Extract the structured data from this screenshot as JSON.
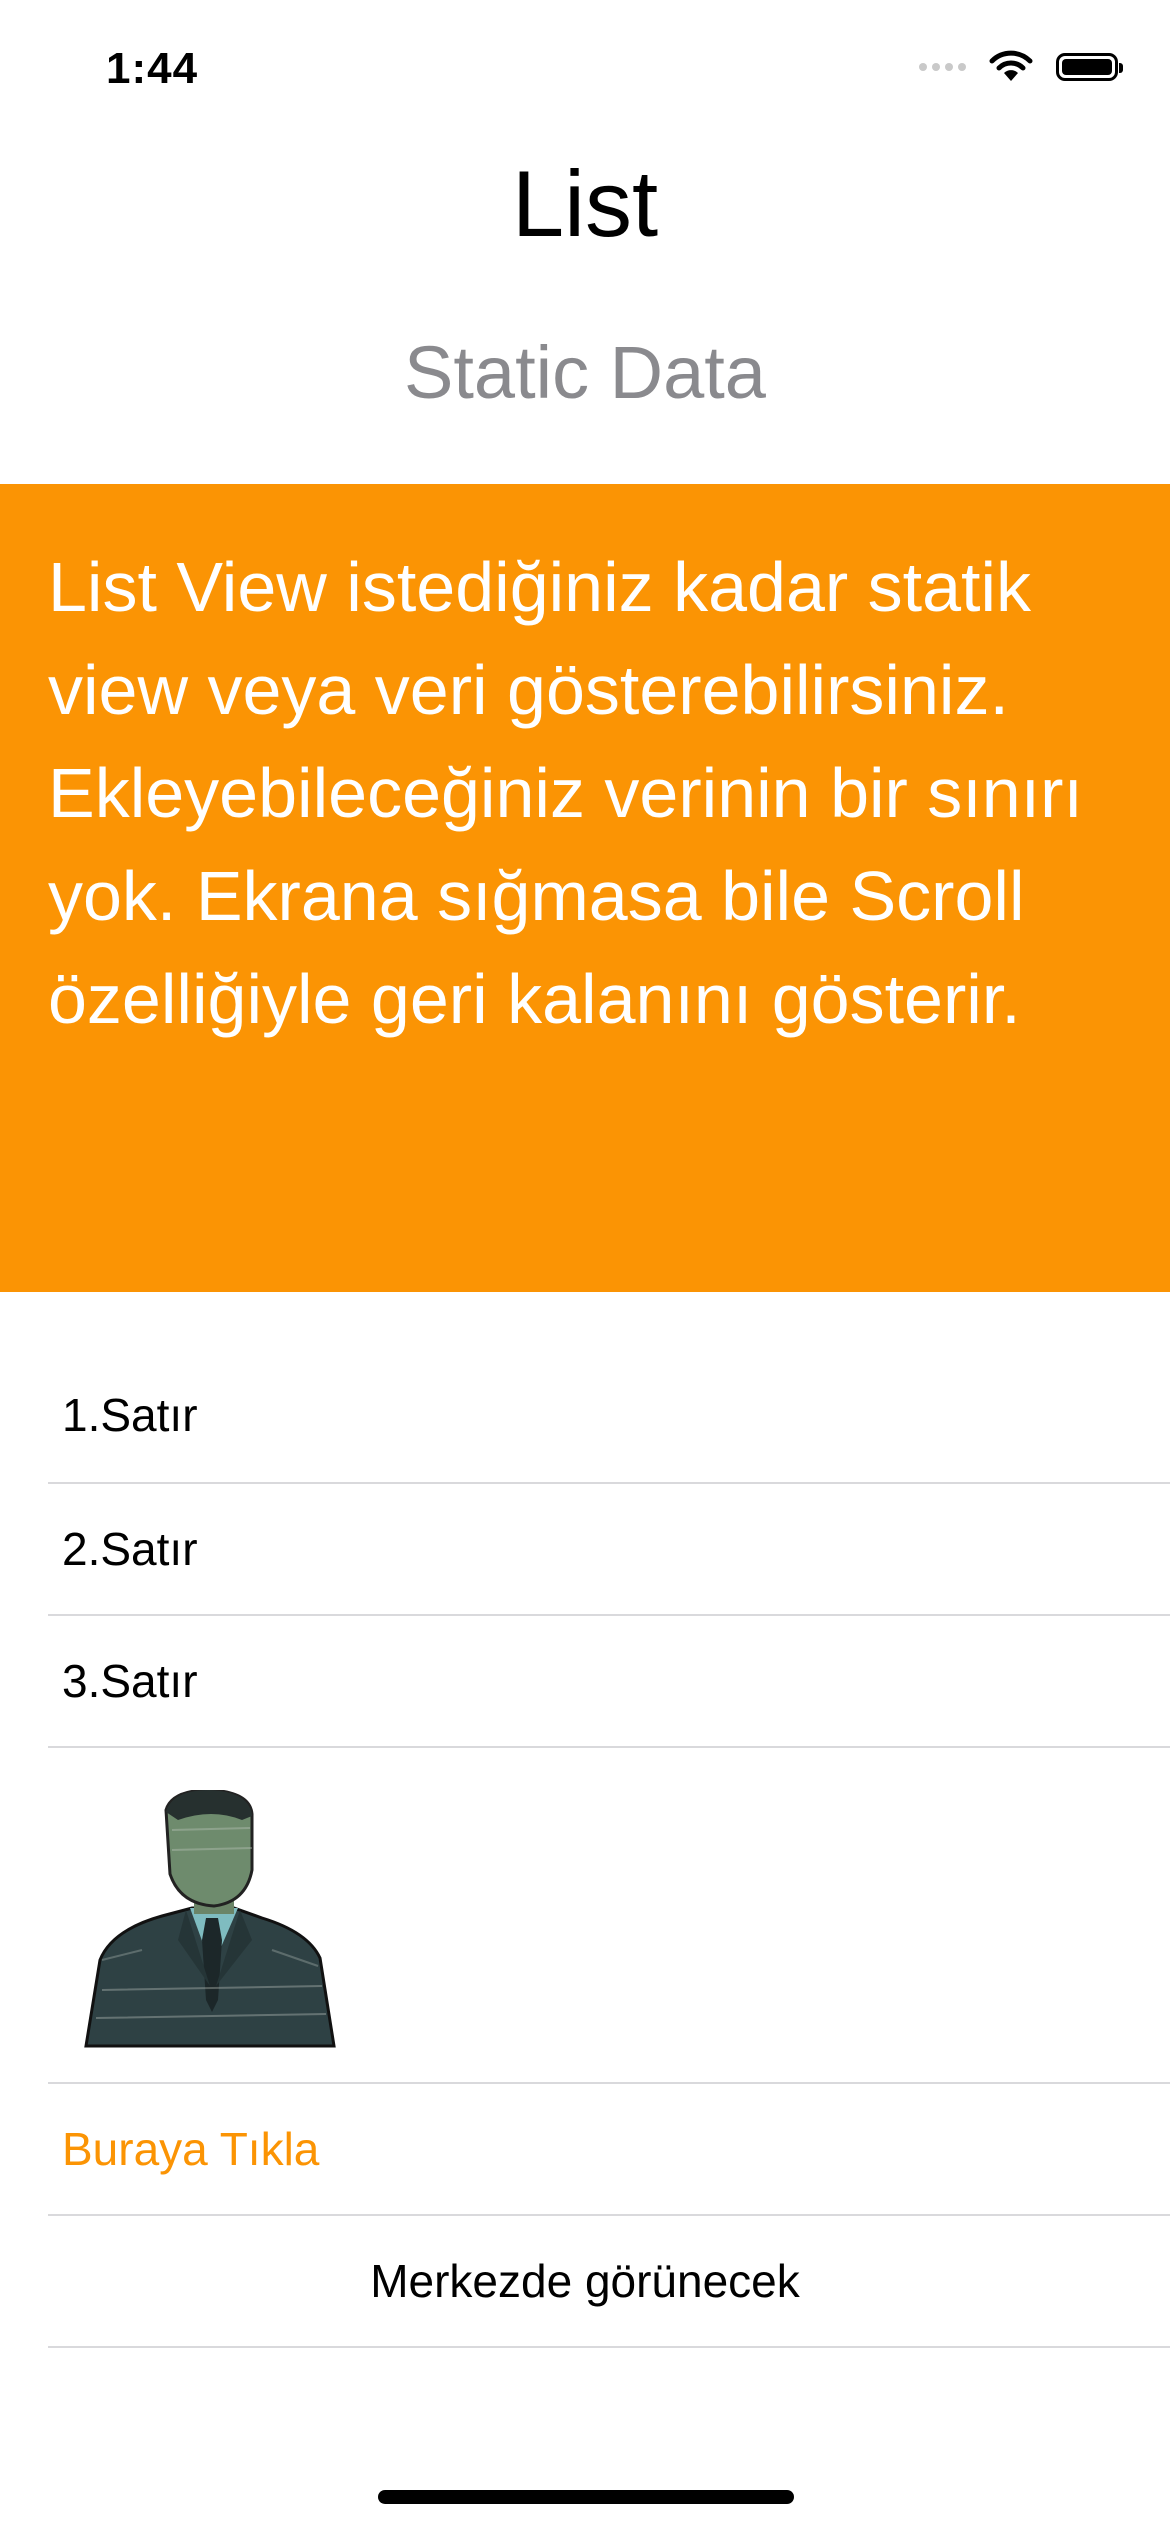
{
  "status_bar": {
    "time": "1:44",
    "icons": [
      "cellular-signal-icon",
      "wifi-icon",
      "battery-icon"
    ]
  },
  "header": {
    "title": "List",
    "subtitle": "Static Data"
  },
  "banner": {
    "text": "List View istediğiniz kadar statik view veya veri gösterebilirsiniz. Ekleyebileceğiniz verinin bir sınırı yok. Ekrana sığmasa bile Scroll özelliğiyle geri kalanını gösterir.",
    "background_color": "#fb9404",
    "text_color": "#ffffff"
  },
  "list": {
    "rows": [
      {
        "label": "1.Satır"
      },
      {
        "label": "2.Satır"
      },
      {
        "label": "3.Satır"
      },
      {
        "image": "man-in-suit-portrait"
      },
      {
        "label": "Buraya Tıkla",
        "color": "#fb9404"
      },
      {
        "label": "Merkezde görünecek"
      }
    ]
  },
  "colors": {
    "accent": "#fb9404",
    "subtitle_gray": "#8a8a8e",
    "separator": "#d9d9dc"
  }
}
